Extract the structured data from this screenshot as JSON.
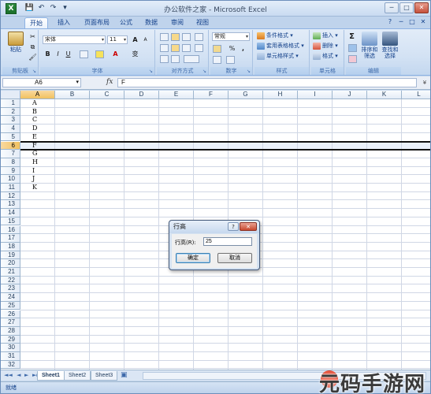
{
  "window": {
    "title": "办公软件之家 - Microsoft Excel",
    "controls": {
      "minimize": "─",
      "maximize": "□",
      "close": "✕"
    }
  },
  "qat": {
    "save": "💾",
    "undo": "↶",
    "redo": "↷",
    "customize": "▾"
  },
  "tabs": [
    "开始",
    "插入",
    "页面布局",
    "公式",
    "数据",
    "审阅",
    "视图"
  ],
  "tabs_right": [
    "?",
    "─",
    "□",
    "✕"
  ],
  "ribbon": {
    "clipboard": {
      "paste": "粘贴",
      "label": "剪贴板"
    },
    "font": {
      "name": "宋体",
      "size": "11",
      "grow": "A",
      "shrink": "A",
      "bold": "B",
      "italic": "I",
      "underline": "U",
      "font_color": "A",
      "phonetic": "变",
      "label": "字体"
    },
    "alignment": {
      "label": "对齐方式"
    },
    "number": {
      "format": "常规",
      "percent": "%",
      "comma": ",",
      "label": "数字"
    },
    "styles": {
      "conditional": "条件格式",
      "table": "套用表格格式",
      "cell": "单元格样式",
      "label": "样式"
    },
    "cells": {
      "insert": "插入",
      "delete": "删除",
      "format": "格式",
      "label": "单元格"
    },
    "editing": {
      "sort": "排序和\n筛选",
      "find": "查找和\n选择",
      "sort_l1": "排序和",
      "sort_l2": "筛选",
      "find_l1": "查找和",
      "find_l2": "选择",
      "sum": "Σ",
      "label": "编辑"
    }
  },
  "formula_bar": {
    "name_box": "A6",
    "fx": "fx",
    "content": "F"
  },
  "columns": [
    "A",
    "B",
    "C",
    "D",
    "E",
    "F",
    "G",
    "H",
    "I",
    "J",
    "K",
    "L"
  ],
  "rows": [
    "1",
    "2",
    "3",
    "4",
    "5",
    "6",
    "7",
    "8",
    "9",
    "10",
    "11",
    "12",
    "13",
    "14",
    "15",
    "16",
    "17",
    "18",
    "19",
    "20",
    "21",
    "22",
    "23",
    "24",
    "25",
    "26",
    "27",
    "28",
    "29",
    "30",
    "31",
    "32"
  ],
  "column_a_values": [
    "A",
    "B",
    "C",
    "D",
    "E",
    "F",
    "G",
    "H",
    "I",
    "J",
    "K"
  ],
  "sheets": [
    "Sheet1",
    "Sheet2",
    "Sheet3"
  ],
  "status": "就绪",
  "dialog": {
    "title": "行高",
    "help": "?",
    "close": "✕",
    "label": "行高(R):",
    "value": "25",
    "ok": "确定",
    "cancel": "取消"
  },
  "watermark": "元码手游网",
  "colors": {
    "accent": "#15428b",
    "ribbon_bg": "#d3e2f4",
    "header_selected": "#f1c15f"
  }
}
